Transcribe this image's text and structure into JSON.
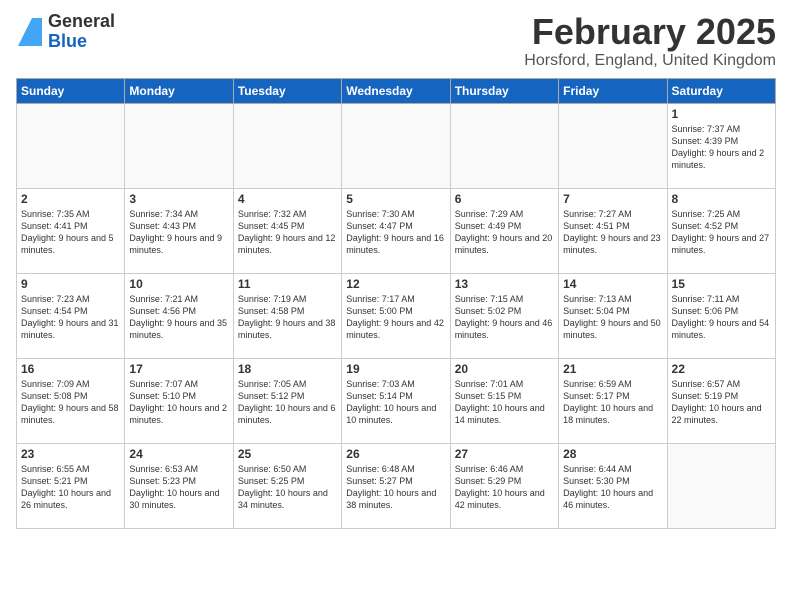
{
  "logo": {
    "general": "General",
    "blue": "Blue"
  },
  "title": "February 2025",
  "subtitle": "Horsford, England, United Kingdom",
  "days_header": [
    "Sunday",
    "Monday",
    "Tuesday",
    "Wednesday",
    "Thursday",
    "Friday",
    "Saturday"
  ],
  "weeks": [
    [
      {
        "day": "",
        "info": ""
      },
      {
        "day": "",
        "info": ""
      },
      {
        "day": "",
        "info": ""
      },
      {
        "day": "",
        "info": ""
      },
      {
        "day": "",
        "info": ""
      },
      {
        "day": "",
        "info": ""
      },
      {
        "day": "1",
        "info": "Sunrise: 7:37 AM\nSunset: 4:39 PM\nDaylight: 9 hours and 2 minutes."
      }
    ],
    [
      {
        "day": "2",
        "info": "Sunrise: 7:35 AM\nSunset: 4:41 PM\nDaylight: 9 hours and 5 minutes."
      },
      {
        "day": "3",
        "info": "Sunrise: 7:34 AM\nSunset: 4:43 PM\nDaylight: 9 hours and 9 minutes."
      },
      {
        "day": "4",
        "info": "Sunrise: 7:32 AM\nSunset: 4:45 PM\nDaylight: 9 hours and 12 minutes."
      },
      {
        "day": "5",
        "info": "Sunrise: 7:30 AM\nSunset: 4:47 PM\nDaylight: 9 hours and 16 minutes."
      },
      {
        "day": "6",
        "info": "Sunrise: 7:29 AM\nSunset: 4:49 PM\nDaylight: 9 hours and 20 minutes."
      },
      {
        "day": "7",
        "info": "Sunrise: 7:27 AM\nSunset: 4:51 PM\nDaylight: 9 hours and 23 minutes."
      },
      {
        "day": "8",
        "info": "Sunrise: 7:25 AM\nSunset: 4:52 PM\nDaylight: 9 hours and 27 minutes."
      }
    ],
    [
      {
        "day": "9",
        "info": "Sunrise: 7:23 AM\nSunset: 4:54 PM\nDaylight: 9 hours and 31 minutes."
      },
      {
        "day": "10",
        "info": "Sunrise: 7:21 AM\nSunset: 4:56 PM\nDaylight: 9 hours and 35 minutes."
      },
      {
        "day": "11",
        "info": "Sunrise: 7:19 AM\nSunset: 4:58 PM\nDaylight: 9 hours and 38 minutes."
      },
      {
        "day": "12",
        "info": "Sunrise: 7:17 AM\nSunset: 5:00 PM\nDaylight: 9 hours and 42 minutes."
      },
      {
        "day": "13",
        "info": "Sunrise: 7:15 AM\nSunset: 5:02 PM\nDaylight: 9 hours and 46 minutes."
      },
      {
        "day": "14",
        "info": "Sunrise: 7:13 AM\nSunset: 5:04 PM\nDaylight: 9 hours and 50 minutes."
      },
      {
        "day": "15",
        "info": "Sunrise: 7:11 AM\nSunset: 5:06 PM\nDaylight: 9 hours and 54 minutes."
      }
    ],
    [
      {
        "day": "16",
        "info": "Sunrise: 7:09 AM\nSunset: 5:08 PM\nDaylight: 9 hours and 58 minutes."
      },
      {
        "day": "17",
        "info": "Sunrise: 7:07 AM\nSunset: 5:10 PM\nDaylight: 10 hours and 2 minutes."
      },
      {
        "day": "18",
        "info": "Sunrise: 7:05 AM\nSunset: 5:12 PM\nDaylight: 10 hours and 6 minutes."
      },
      {
        "day": "19",
        "info": "Sunrise: 7:03 AM\nSunset: 5:14 PM\nDaylight: 10 hours and 10 minutes."
      },
      {
        "day": "20",
        "info": "Sunrise: 7:01 AM\nSunset: 5:15 PM\nDaylight: 10 hours and 14 minutes."
      },
      {
        "day": "21",
        "info": "Sunrise: 6:59 AM\nSunset: 5:17 PM\nDaylight: 10 hours and 18 minutes."
      },
      {
        "day": "22",
        "info": "Sunrise: 6:57 AM\nSunset: 5:19 PM\nDaylight: 10 hours and 22 minutes."
      }
    ],
    [
      {
        "day": "23",
        "info": "Sunrise: 6:55 AM\nSunset: 5:21 PM\nDaylight: 10 hours and 26 minutes."
      },
      {
        "day": "24",
        "info": "Sunrise: 6:53 AM\nSunset: 5:23 PM\nDaylight: 10 hours and 30 minutes."
      },
      {
        "day": "25",
        "info": "Sunrise: 6:50 AM\nSunset: 5:25 PM\nDaylight: 10 hours and 34 minutes."
      },
      {
        "day": "26",
        "info": "Sunrise: 6:48 AM\nSunset: 5:27 PM\nDaylight: 10 hours and 38 minutes."
      },
      {
        "day": "27",
        "info": "Sunrise: 6:46 AM\nSunset: 5:29 PM\nDaylight: 10 hours and 42 minutes."
      },
      {
        "day": "28",
        "info": "Sunrise: 6:44 AM\nSunset: 5:30 PM\nDaylight: 10 hours and 46 minutes."
      },
      {
        "day": "",
        "info": ""
      }
    ]
  ]
}
